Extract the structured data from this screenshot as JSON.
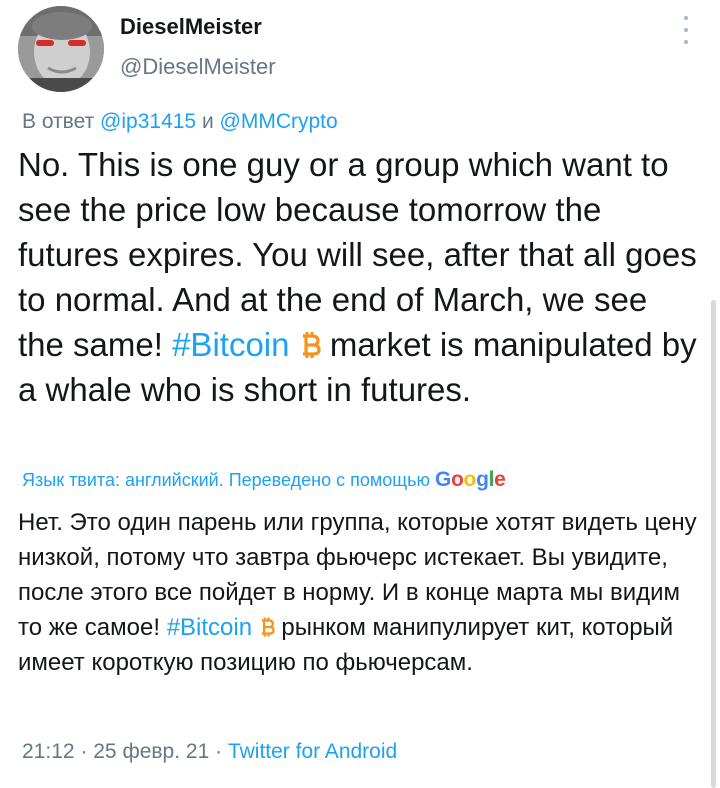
{
  "user": {
    "display_name": "DieselMeister",
    "handle": "@DieselMeister"
  },
  "reply": {
    "prefix": "В ответ",
    "mention1": "@ip31415",
    "joiner": "и",
    "mention2": "@MMCrypto"
  },
  "tweet": {
    "text_part1": "No. This is one guy or a group which want to see the price low because tomorrow the futures expires. You will see, after that all goes to normal. And at the end of March, we see the same! ",
    "hashtag": "#Bitcoin",
    "text_part2": " market is manipulated by a whale who is short in futures."
  },
  "translation": {
    "label": "Язык твита: английский. Переведено с помощью",
    "provider": "Google",
    "text_part1": "Нет. Это один парень или группа, которые хотят видеть цену низкой, потому что завтра фьючерс истекает. Вы увидите, после этого все пойдет в норму. И в конце марта мы видим то же самое! ",
    "hashtag": "#Bitcoin",
    "text_part2": " рынком манипулирует кит, который имеет короткую позицию по фьючерсам."
  },
  "meta": {
    "time": "21:12",
    "sep1": "·",
    "date": "25 февр. 21",
    "sep2": "·",
    "client": "Twitter for Android"
  },
  "icons": {
    "avatar": "user-avatar",
    "more": "more-options-icon",
    "bitcoin": "bitcoin-emoji-icon"
  },
  "colors": {
    "link": "#1da1f2",
    "secondary_text": "#657786",
    "bitcoin": "#f7931a"
  }
}
